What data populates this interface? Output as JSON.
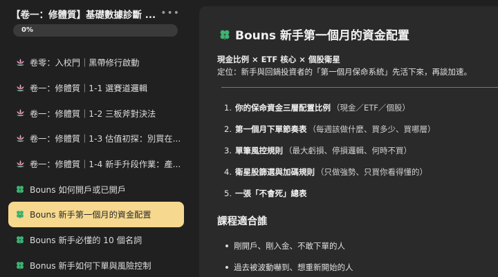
{
  "sidebar": {
    "title": "【卷一：修體質】基礎數據診斷 ...",
    "more_icon": "ellipsis-icon",
    "progress": {
      "label": "0%",
      "value": 0
    },
    "items": [
      {
        "icon": "lotus-icon",
        "label": "卷零：入校門｜黑帶修行啟動"
      },
      {
        "icon": "lotus-icon",
        "label": "卷一：修體質｜1-1 選賽道邏輯"
      },
      {
        "icon": "lotus-icon",
        "label": "卷一：修體質｜1-2 三板斧對決法"
      },
      {
        "icon": "lotus-icon",
        "label": "卷一：修體質｜1-3 估值初探：別買在..."
      },
      {
        "icon": "lotus-icon",
        "label": "卷一：修體質｜1-4 新手升段作業：產..."
      },
      {
        "icon": "clover-icon",
        "label": "Bouns 如何開戶或已開戶"
      },
      {
        "icon": "clover-icon",
        "label": "Bouns 新手第一個月的資金配置",
        "active": true
      },
      {
        "icon": "clover-icon",
        "label": "Bouns 新手必懂的 10 個名詞"
      },
      {
        "icon": "clover-icon",
        "label": "Bonus 新手如何下單與風險控制"
      }
    ]
  },
  "main": {
    "title": "Bouns 新手第一個月的資金配置",
    "subtitle": "現金比例 × ETF 核心 × 個股衛星",
    "description": "定位：新手與回鍋投資者的「第一個月保命系統」先活下來，再談加速。",
    "steps": [
      {
        "num": "1.",
        "bold": "你的保命資金三層配置比例",
        "note": "（現金／ETF／個股）"
      },
      {
        "num": "2.",
        "bold": "第一個月下單節奏表",
        "note": "（每週該做什麼、買多少、買哪層）"
      },
      {
        "num": "3.",
        "bold": "單筆風控規則",
        "note": "（最大虧損、停損邏輯、何時不買）"
      },
      {
        "num": "4.",
        "bold": "衛星股篩選與加碼規則",
        "note": "（只做強勢、只買你看得懂的）"
      },
      {
        "num": "5.",
        "bold": "一張「不會死」總表",
        "note": ""
      }
    ],
    "audience_heading": "課程適合誰",
    "audience": [
      "剛開戶、剛入金、不敢下單的人",
      "過去被波動嚇到、想重新開始的人"
    ]
  },
  "colors": {
    "background": "#202020",
    "panel": "#2a2a2a",
    "active_item": "#f6d88e",
    "clover": "#3cb371"
  }
}
